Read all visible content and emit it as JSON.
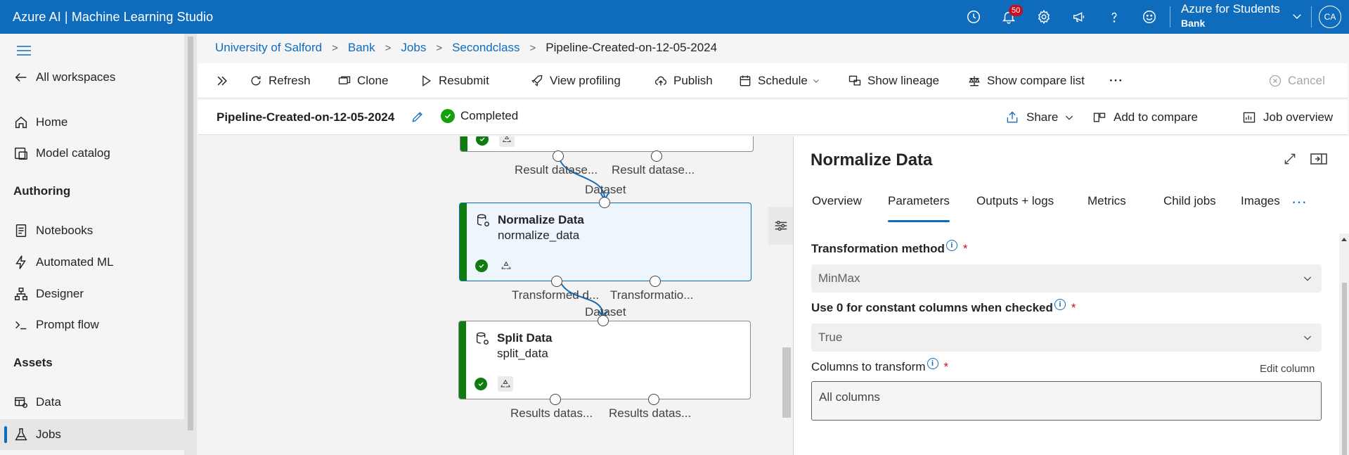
{
  "app": {
    "title": "Azure AI | Machine Learning Studio"
  },
  "topbar": {
    "notifications_count": "50",
    "account_name": "Azure for Students",
    "account_sub": "Bank",
    "avatar_initials": "CA"
  },
  "nav": {
    "all_workspaces": "All workspaces",
    "home": "Home",
    "model_catalog": "Model catalog",
    "authoring_heading": "Authoring",
    "notebooks": "Notebooks",
    "automated_ml": "Automated ML",
    "designer": "Designer",
    "prompt_flow": "Prompt flow",
    "assets_heading": "Assets",
    "data": "Data",
    "jobs": "Jobs"
  },
  "breadcrumb": {
    "items": [
      "University of Salford",
      "Bank",
      "Jobs",
      "Secondclass"
    ],
    "current": "Pipeline-Created-on-12-05-2024"
  },
  "toolbar": {
    "refresh": "Refresh",
    "clone": "Clone",
    "resubmit": "Resubmit",
    "view_profiling": "View profiling",
    "publish": "Publish",
    "schedule": "Schedule",
    "show_lineage": "Show lineage",
    "show_compare_list": "Show compare list",
    "more": "···",
    "cancel": "Cancel"
  },
  "job": {
    "name": "Pipeline-Created-on-12-05-2024",
    "status": "Completed",
    "share": "Share",
    "add_to_compare": "Add to compare",
    "job_overview": "Job overview"
  },
  "canvas": {
    "top_node_ports": [
      "Result datase...",
      "Result datase..."
    ],
    "edge1_label": "Dataset",
    "normalize_node": {
      "title": "Normalize Data",
      "subtitle": "normalize_data",
      "ports": [
        "Transformed d...",
        "Transformatio..."
      ]
    },
    "edge2_label": "Dataset",
    "split_node": {
      "title": "Split Data",
      "subtitle": "split_data",
      "ports": [
        "Results datas...",
        "Results datas..."
      ]
    }
  },
  "panel": {
    "title": "Normalize Data",
    "tabs": [
      "Overview",
      "Parameters",
      "Outputs + logs",
      "Metrics",
      "Child jobs",
      "Images"
    ],
    "active_tab": "Parameters",
    "more": "···",
    "fields": {
      "transformation_label": "Transformation method",
      "transformation_value": "MinMax",
      "constant_label": "Use 0 for constant columns when checked",
      "constant_value": "True",
      "columns_label": "Columns to transform",
      "edit_column": "Edit column",
      "columns_value": "All columns"
    },
    "required_mark": "*",
    "info_mark": "i"
  },
  "colors": {
    "accent": "#0f6cbd",
    "success": "#107c10",
    "badge": "#c50f1f"
  }
}
